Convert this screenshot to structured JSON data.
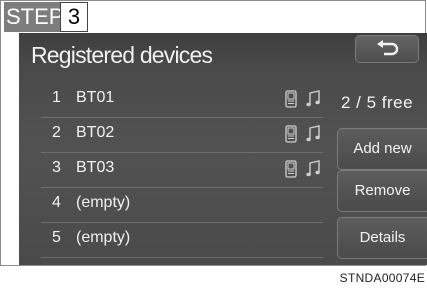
{
  "step": {
    "label": "STEP",
    "number": "3"
  },
  "screen": {
    "title": "Registered devices",
    "back_button": {
      "icon": "back-arrow-icon"
    },
    "free_status": "2 / 5 free",
    "devices": [
      {
        "index": "1",
        "name": "BT01",
        "has_phone": true,
        "has_audio": true
      },
      {
        "index": "2",
        "name": "BT02",
        "has_phone": true,
        "has_audio": true
      },
      {
        "index": "3",
        "name": "BT03",
        "has_phone": true,
        "has_audio": true
      },
      {
        "index": "4",
        "name": "(empty)",
        "has_phone": false,
        "has_audio": false
      },
      {
        "index": "5",
        "name": "(empty)",
        "has_phone": false,
        "has_audio": false
      }
    ],
    "buttons": {
      "add_new": "Add new",
      "remove": "Remove",
      "details": "Details"
    }
  },
  "figure_code": "STNDA00074E",
  "colors": {
    "screen_bg": "#4e4e4e",
    "text": "#f2f2f2",
    "step_bg": "#7d7d7d"
  }
}
